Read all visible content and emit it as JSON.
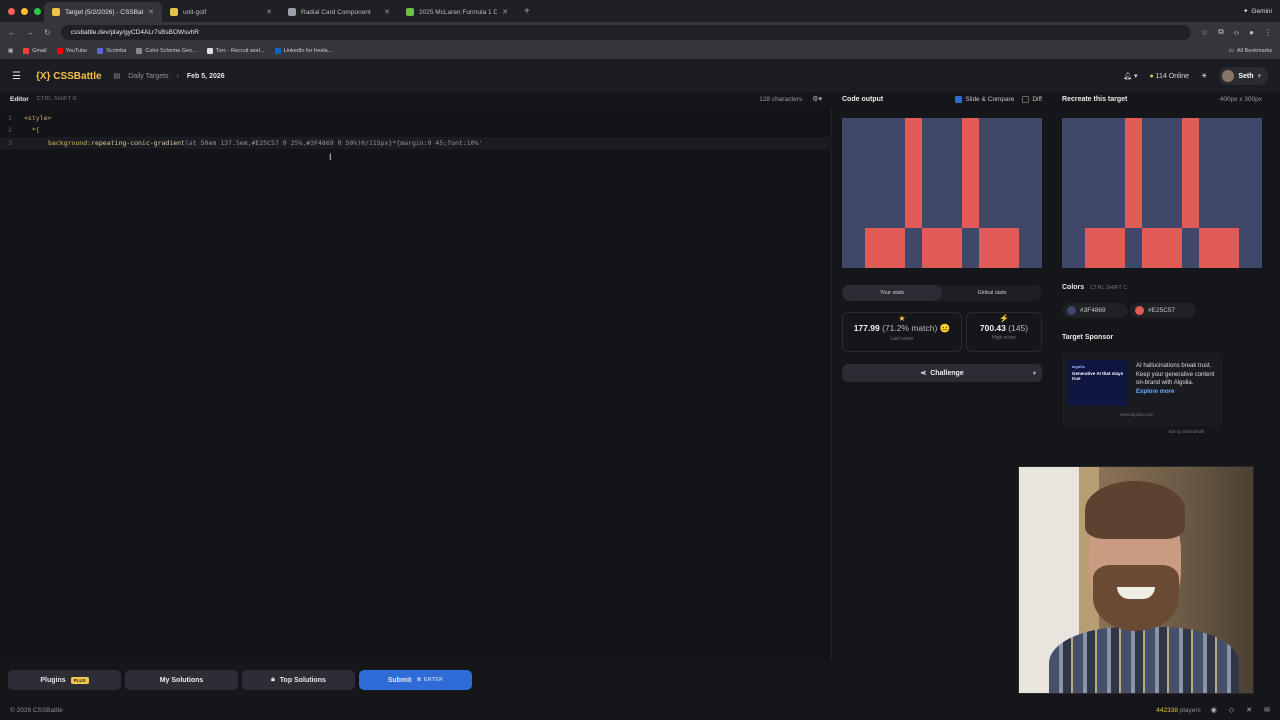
{
  "browser": {
    "tabs": [
      {
        "label": "Target (5/2/2026) - CSSBattle",
        "favicon_color": "#f3c04a",
        "active": true
      },
      {
        "label": "unit-golf",
        "favicon_color": "#e3c443",
        "active": false
      },
      {
        "label": "Radial Card Component",
        "favicon_color": "#9aa0a6",
        "active": false
      },
      {
        "label": "2025 McLaren Formula 1 Dri...",
        "favicon_color": "#6cc04a",
        "active": false
      }
    ],
    "new_tab": "+",
    "gemini": "Gemini",
    "url": "cssbattle.dev/play/gyCD4ALr7sBsBOWsvhR",
    "bookmarks": [
      {
        "label": "Gmail",
        "color": "#ea4335"
      },
      {
        "label": "YouTube",
        "color": "#ff0000"
      },
      {
        "label": "Scrimba",
        "color": "#5a67d8"
      },
      {
        "label": "Color Scheme Gen...",
        "color": "#888888"
      },
      {
        "label": "Torc - Recruit worl...",
        "color": "#e0e0e0"
      },
      {
        "label": "LinkedIn for freela...",
        "color": "#0a66c2"
      }
    ],
    "all_bookmarks": "All Bookmarks"
  },
  "header": {
    "logo": "{X} CSSBattle",
    "daily_targets": "Daily Targets",
    "date": "Feb 5, 2026",
    "online_count": "114",
    "online_label": "Online",
    "user": "Seth"
  },
  "editor": {
    "title": "Editor",
    "shortcut": "CTRL  SHIFT  E",
    "chars": "128 characters",
    "lines": [
      {
        "num": "1",
        "code": "<style>"
      },
      {
        "num": "2",
        "code": "  *{"
      },
      {
        "num": "3",
        "prop": "background:",
        "fn": "repeating-conic-gradient",
        "rest": "(at 50em 137.5em,#E25C57 0 25%,#3F4869 0 50%)0/115px}*{margin:0 45;font:10%'"
      }
    ]
  },
  "buttons": {
    "plugins": "Plugins",
    "plus": "PLUS",
    "my_solutions": "My Solutions",
    "top_solutions": "Top Solutions",
    "submit": "Submit",
    "enter": "ENTER"
  },
  "output": {
    "title": "Code output",
    "slide_compare": "Slide & Compare",
    "diff": "Diff"
  },
  "target": {
    "title": "Recreate this target",
    "size": "400px x 300px"
  },
  "stats": {
    "your_stats": "Your stats",
    "global_stats": "Global stats",
    "last_score": "177.99",
    "match": "(71.2% match)",
    "last_score_label": "Last score",
    "high_score": "700.43",
    "high_score_chars": "(145)",
    "high_score_label": "High score",
    "challenge": "Challenge"
  },
  "colors": {
    "title": "Colors",
    "shortcut": "CTRL  SHIFT  C",
    "swatches": [
      {
        "hex": "#3F4869",
        "label": "#3F4869"
      },
      {
        "hex": "#E25C57",
        "label": "#E25C57"
      }
    ]
  },
  "sponsor": {
    "title": "Target Sponsor",
    "ad_image_text": "Generative AI that stays true",
    "ad_brand": "algolia",
    "ad_text": "AI hallucinations break trust. Keep your generative content on-brand with Algolia.",
    "ad_link": "Explore more",
    "domain": "www.algolia.com",
    "ads_by": "Ads by EthicalAds"
  },
  "footer": {
    "copyright": "© 2026 CSSBattle",
    "players_count": "442338",
    "players_label": "players"
  }
}
